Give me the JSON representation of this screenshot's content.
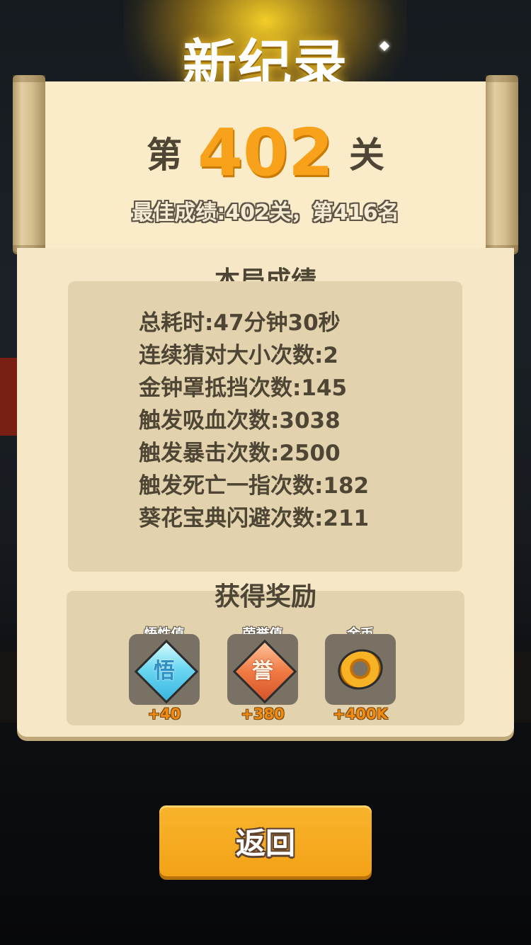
{
  "header": {
    "title": "新纪录"
  },
  "level": {
    "prefix": "第",
    "number": "402",
    "suffix": "关"
  },
  "best_record": "最佳成绩:402关，第416名",
  "round_stats": {
    "title": "本局成绩",
    "lines": [
      "总耗时:47分钟30秒",
      "连续猜对大小次数:2",
      "金钟罩抵挡次数:145",
      "触发吸血次数:3038",
      "触发暴击次数:2500",
      "触发死亡一指次数:182",
      "葵花宝典闪避次数:211"
    ]
  },
  "rewards": {
    "title": "获得奖励",
    "items": [
      {
        "label": "悟性值",
        "glyph": "悟",
        "amount": "+40",
        "icon": "insight-diamond-icon",
        "color": "#6bd7f2"
      },
      {
        "label": "荣誉值",
        "glyph": "誉",
        "amount": "+380",
        "icon": "honor-diamond-icon",
        "color": "#f07a43"
      },
      {
        "label": "金币",
        "amount": "+400K",
        "icon": "gold-coin-icon",
        "color": "#f8b225"
      }
    ]
  },
  "actions": {
    "back_label": "返回"
  }
}
